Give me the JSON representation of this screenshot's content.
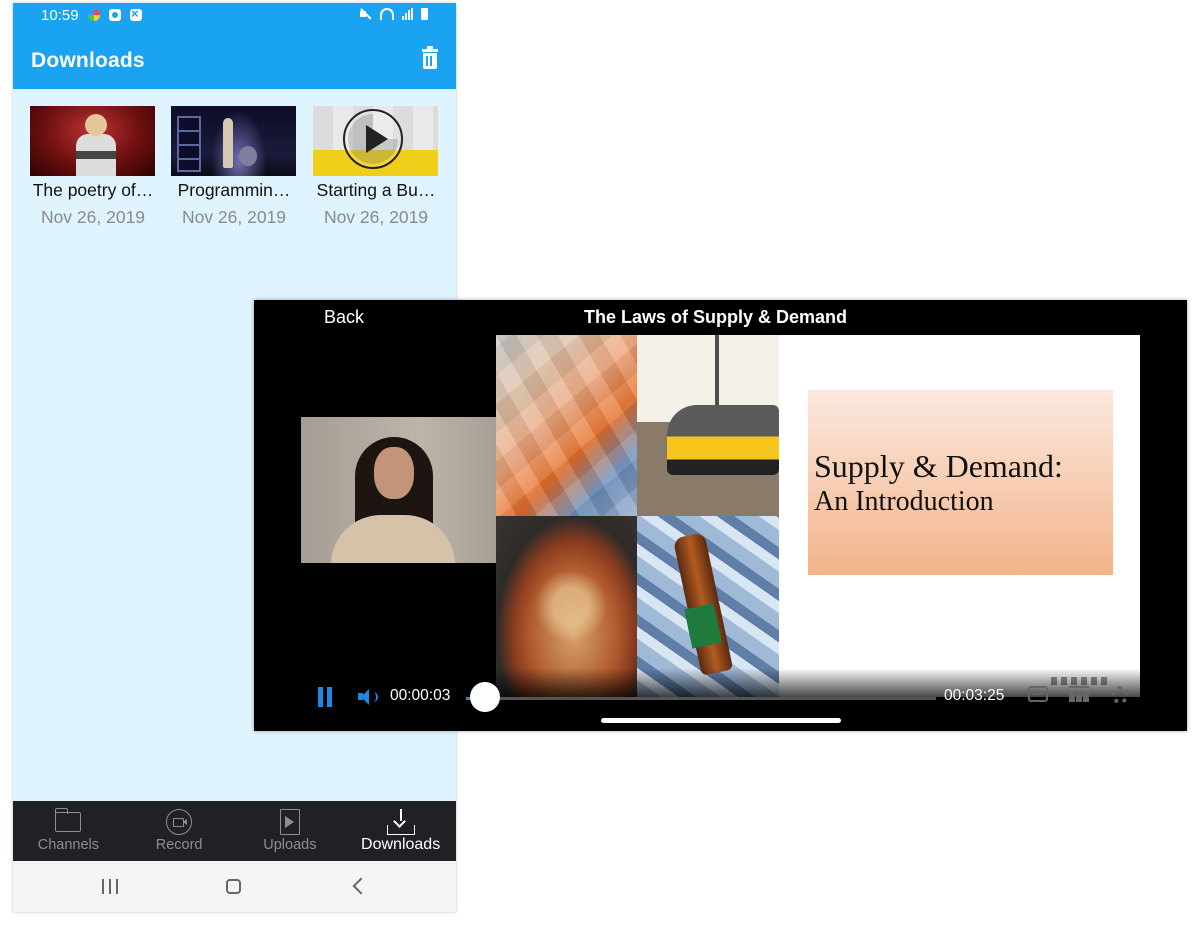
{
  "status_bar": {
    "time": "10:59"
  },
  "app_bar": {
    "title": "Downloads"
  },
  "downloads": [
    {
      "title": "The poetry of…",
      "date": "Nov 26, 2019"
    },
    {
      "title": "Programmin…",
      "date": "Nov 26, 2019"
    },
    {
      "title": "Starting a Bu…",
      "date": "Nov 26, 2019"
    }
  ],
  "tabs": [
    {
      "label": "Channels",
      "icon": "folder-icon"
    },
    {
      "label": "Record",
      "icon": "record-icon"
    },
    {
      "label": "Uploads",
      "icon": "upload-icon"
    },
    {
      "label": "Downloads",
      "icon": "download-icon",
      "active": true
    }
  ],
  "player": {
    "back_label": "Back",
    "title": "The Laws of Supply & Demand",
    "current_time": "00:00:03",
    "total_time": "00:03:25",
    "progress": 0.015,
    "slide": {
      "title": "Supply & Demand:",
      "subtitle": "An Introduction"
    }
  },
  "colors": {
    "primary": "#1aa3f0",
    "list_background": "#dff4ff",
    "tabbar_background": "#202124",
    "player_accent": "#1e88e5"
  }
}
